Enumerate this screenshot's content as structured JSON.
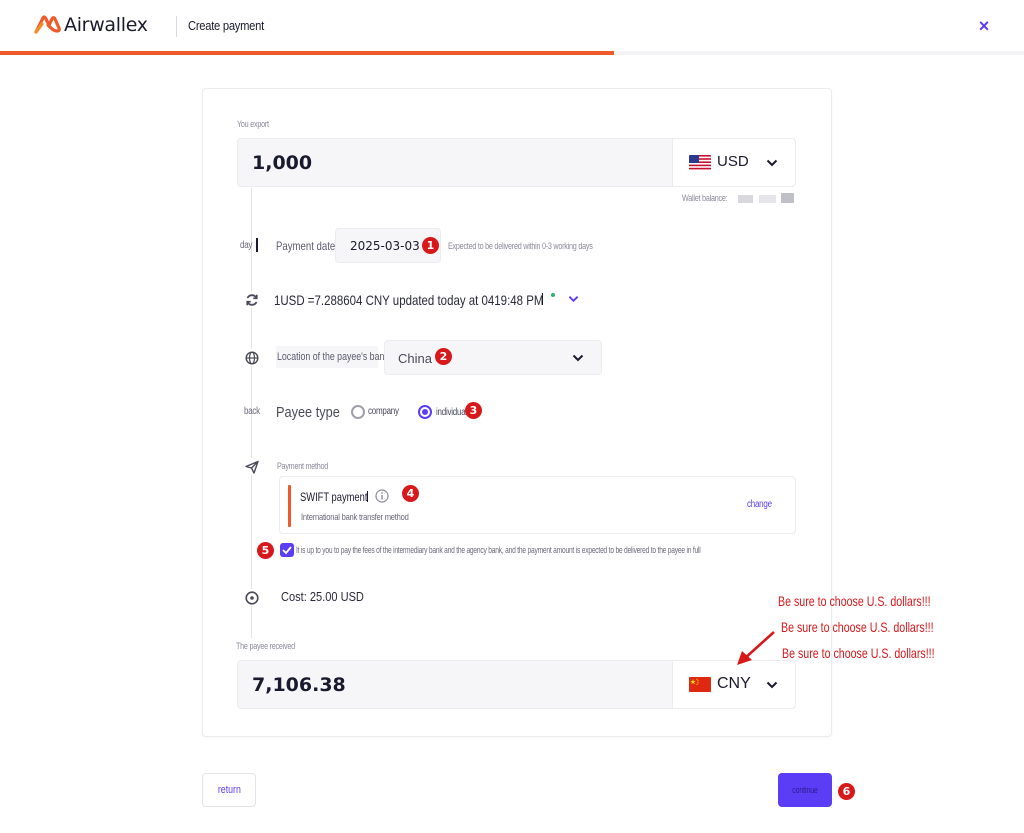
{
  "app": {
    "brand": "Airwallex",
    "page_title": "Create payment",
    "close_icon": "×"
  },
  "progress": {
    "fraction": 0.6
  },
  "export": {
    "label": "You export",
    "amount": "1,000",
    "currency": "USD",
    "wallet_label": "Wallet balance:"
  },
  "payment_date": {
    "side_label": "day",
    "label": "Payment date",
    "value": "2025-03-03",
    "hint": "Expected to be delivered within 0-3 working days"
  },
  "rate": {
    "text": "1USD =7.288604 CNY updated today at 0419:48 PM"
  },
  "location": {
    "label": "Location of the payee's bank",
    "value": "China"
  },
  "payee_type": {
    "side_label": "back",
    "label": "Payee type",
    "options": [
      "company",
      "individual"
    ],
    "selected": "individual"
  },
  "payment_method": {
    "label": "Payment method",
    "title": "SWIFT payment",
    "subtitle": "International bank transfer method",
    "change": "change"
  },
  "fees": {
    "text": "It is up to you to pay the fees of the intermediary bank and the agency bank, and the payment amount is expected to be delivered to the payee in full",
    "checked": true
  },
  "cost": {
    "text": "Cost: 25.00 USD"
  },
  "received": {
    "label": "The payee received",
    "amount": "7,106.38",
    "currency": "CNY"
  },
  "annotations": {
    "note1": "Be sure to choose U.S. dollars!!!",
    "note2": "Be sure to choose U.S. dollars!!!",
    "note3": "Be sure to choose U.S. dollars!!!",
    "badges": [
      "1",
      "2",
      "3",
      "4",
      "5",
      "6"
    ],
    "color": "#d7191c"
  },
  "footer": {
    "return": "return",
    "continue": "continue"
  },
  "colors": {
    "accent": "#5b3df5",
    "brand": "#ef5a2a",
    "annotation": "#d7191c"
  }
}
